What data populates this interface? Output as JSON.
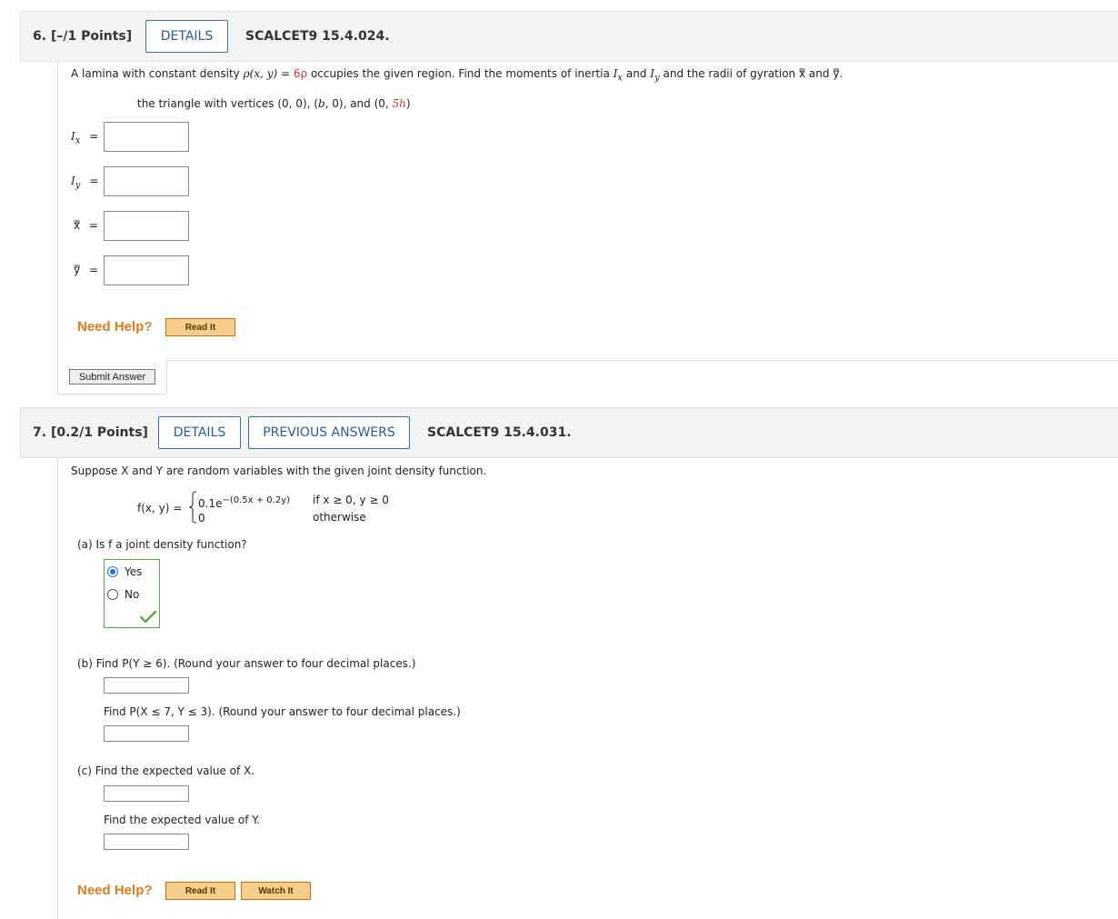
{
  "q6": {
    "number": "6.",
    "points": "[–/1 Points]",
    "details_label": "DETAILS",
    "code": "SCALCET9 15.4.024.",
    "prompt_a": "A lamina with constant density ",
    "prompt_rho": "ρ(x, y) = ",
    "prompt_rho_val": "6ρ",
    "prompt_b": " occupies the given region. Find the moments of inertia ",
    "ix": "I",
    "ix_sub": "x",
    "and1": " and ",
    "iy": "I",
    "iy_sub": "y",
    "prompt_c": " and the radii of gyration ",
    "xbar": "x̿",
    "and2": " and ",
    "ybar": "y̿",
    "prompt_end": ".",
    "region_a": "the triangle with vertices (0, 0), (",
    "region_b": "b",
    "region_c": ", 0), and (0, ",
    "region_d": "5h",
    "region_e": ")",
    "labels": {
      "ix": "I",
      "ix_sub": "x",
      "iy": "I",
      "iy_sub": "y",
      "xbar": "x̿",
      "ybar": "y̿",
      "eq": "="
    },
    "need_help": "Need Help?",
    "read_it": "Read It",
    "submit": "Submit Answer"
  },
  "q7": {
    "number": "7.",
    "points": "[0.2/1 Points]",
    "details_label": "DETAILS",
    "previous_label": "PREVIOUS ANSWERS",
    "code": "SCALCET9 15.4.031.",
    "prompt": "Suppose X and Y are random variables with the given joint density function.",
    "fxy": "f(x, y) =",
    "case1": "0.1e",
    "case1_exp": "−(0.5x + 0.2y)",
    "cond1": "if x ≥ 0, y ≥ 0",
    "case2": "0",
    "cond2": "otherwise",
    "part_a": "(a)   Is f a joint density function?",
    "option_yes": "Yes",
    "option_no": "No",
    "part_b": "(b)   Find P(Y ≥ 6). (Round your answer to four decimal places.)",
    "part_b2": "Find P(X ≤ 7, Y ≤ 3). (Round your answer to four decimal places.)",
    "part_c": "(c)   Find the expected value of X.",
    "part_c2": "Find the expected value of Y.",
    "need_help": "Need Help?",
    "read_it": "Read It",
    "watch_it": "Watch It",
    "check_color": "#5fa84a"
  }
}
